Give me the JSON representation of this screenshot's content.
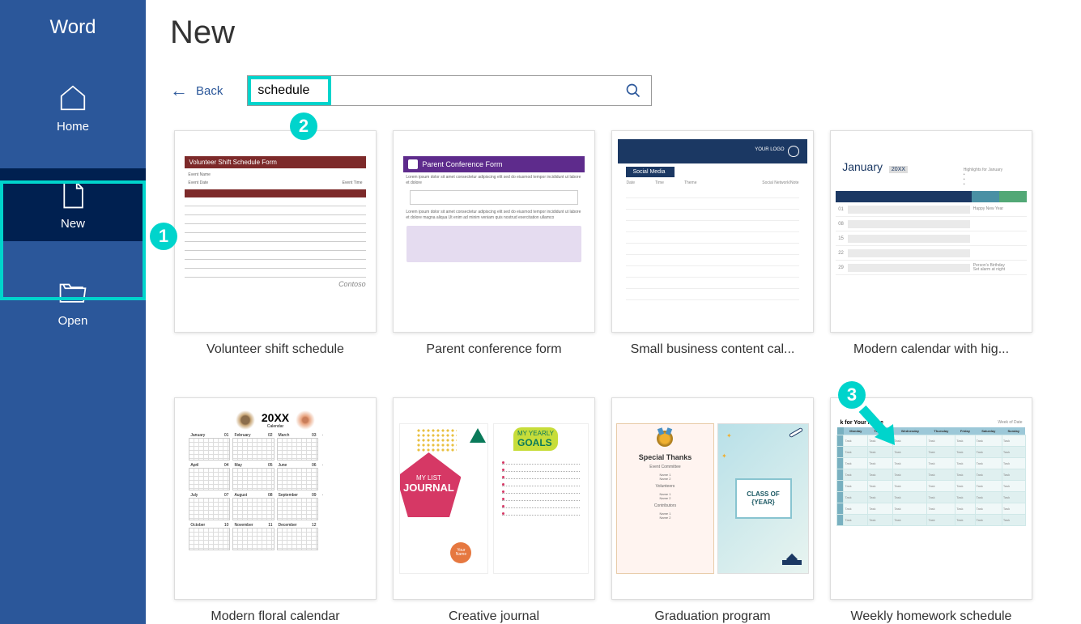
{
  "app": {
    "name": "Word"
  },
  "sidebar": {
    "items": [
      {
        "id": "home",
        "label": "Home"
      },
      {
        "id": "new",
        "label": "New"
      },
      {
        "id": "open",
        "label": "Open"
      }
    ]
  },
  "page": {
    "title": "New"
  },
  "search": {
    "back_label": "Back",
    "query": "schedule"
  },
  "templates": [
    {
      "id": "volunteer",
      "label": "Volunteer shift schedule",
      "thumb_title": "Volunteer Shift Schedule Form",
      "logo": "Contoso"
    },
    {
      "id": "conference",
      "label": "Parent conference form",
      "thumb_title": "Parent Conference Form"
    },
    {
      "id": "smallbiz",
      "label": "Small business content cal...",
      "thumb_tab": "Social Media",
      "thumb_logo": "YOUR LOGO",
      "thumb_cols": [
        "Date",
        "Time",
        "Theme",
        "Social Network/Note"
      ]
    },
    {
      "id": "moderncal",
      "label": "Modern calendar with hig...",
      "thumb_month": "January",
      "thumb_year_tag": "20XX"
    },
    {
      "id": "floral",
      "label": "Modern floral calendar",
      "thumb_year": "20XX",
      "thumb_sub": "Calendar",
      "months": [
        "January",
        "February",
        "March",
        "April",
        "May",
        "June",
        "July",
        "August",
        "September",
        "October",
        "November",
        "December"
      ]
    },
    {
      "id": "journal",
      "label": "Creative journal",
      "left_line1": "MY LIST",
      "left_line2": "JOURNAL",
      "right_line1": "MY YEARLY",
      "right_line2": "GOALS"
    },
    {
      "id": "graduation",
      "label": "Graduation program",
      "left_title": "Special Thanks",
      "left_sections": [
        "Event Committee",
        "Volunteers",
        "Contributors"
      ],
      "right_text": "CLASS OF {YEAR}"
    },
    {
      "id": "homework",
      "label": "Weekly homework schedule",
      "thumb_title_left": "k for Your Name",
      "thumb_title_right": "Week of Date",
      "days": [
        "Monday",
        "Tuesday",
        "Wednesday",
        "Thursday",
        "Friday",
        "Saturday",
        "Sunday"
      ]
    }
  ],
  "annotations": {
    "a1": "1",
    "a2": "2",
    "a3": "3"
  }
}
